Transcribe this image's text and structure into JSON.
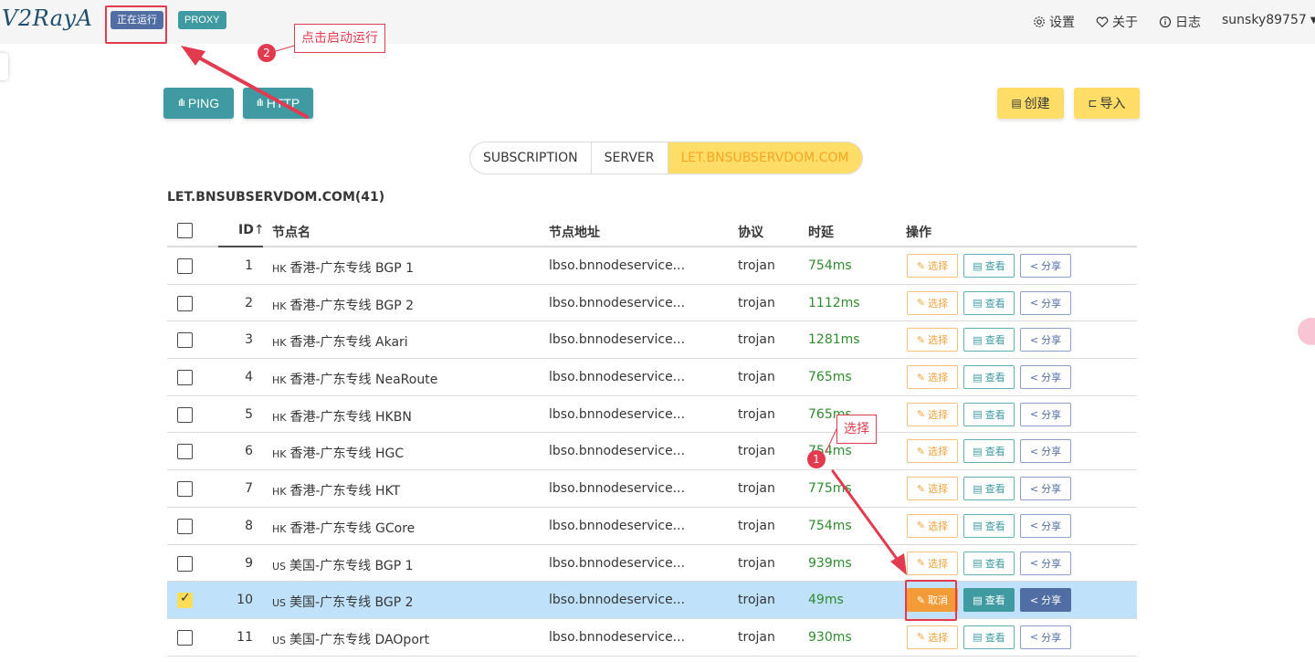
{
  "header": {
    "logo": "V2RayA",
    "status_tag": "正在运行",
    "proxy_tag": "PROXY",
    "nav": {
      "settings": "设置",
      "about": "关于",
      "log": "日志",
      "user": "sunsky89757"
    }
  },
  "toolbar": {
    "ping_label": "PING",
    "http_label": "HTTP",
    "create_label": "创建",
    "import_label": "导入"
  },
  "tabs": [
    {
      "label": "SUBSCRIPTION",
      "active": false
    },
    {
      "label": "SERVER",
      "active": false
    },
    {
      "label": "LET.BNSUBSERVDOM.COM",
      "active": true
    }
  ],
  "list": {
    "title": "LET.BNSUBSERVDOM.COM(41)",
    "columns": {
      "id": "ID",
      "name": "节点名",
      "address": "节点地址",
      "protocol": "协议",
      "latency": "时延",
      "actions": "操作"
    },
    "action_labels": {
      "select": "选择",
      "cancel": "取消",
      "view": "查看",
      "share": "分享"
    },
    "rows": [
      {
        "id": "1",
        "flag": "HK",
        "name": "香港-广东专线 BGP 1",
        "address": "lbso.bnnodeservice...",
        "protocol": "trojan",
        "latency": "754ms",
        "selected": false
      },
      {
        "id": "2",
        "flag": "HK",
        "name": "香港-广东专线 BGP 2",
        "address": "lbso.bnnodeservice...",
        "protocol": "trojan",
        "latency": "1112ms",
        "selected": false
      },
      {
        "id": "3",
        "flag": "HK",
        "name": "香港-广东专线 Akari",
        "address": "lbso.bnnodeservice...",
        "protocol": "trojan",
        "latency": "1281ms",
        "selected": false
      },
      {
        "id": "4",
        "flag": "HK",
        "name": "香港-广东专线 NeaRoute",
        "address": "lbso.bnnodeservice...",
        "protocol": "trojan",
        "latency": "765ms",
        "selected": false
      },
      {
        "id": "5",
        "flag": "HK",
        "name": "香港-广东专线 HKBN",
        "address": "lbso.bnnodeservice...",
        "protocol": "trojan",
        "latency": "765ms",
        "selected": false
      },
      {
        "id": "6",
        "flag": "HK",
        "name": "香港-广东专线 HGC",
        "address": "lbso.bnnodeservice...",
        "protocol": "trojan",
        "latency": "754ms",
        "selected": false
      },
      {
        "id": "7",
        "flag": "HK",
        "name": "香港-广东专线 HKT",
        "address": "lbso.bnnodeservice...",
        "protocol": "trojan",
        "latency": "775ms",
        "selected": false
      },
      {
        "id": "8",
        "flag": "HK",
        "name": "香港-广东专线 GCore",
        "address": "lbso.bnnodeservice...",
        "protocol": "trojan",
        "latency": "754ms",
        "selected": false
      },
      {
        "id": "9",
        "flag": "US",
        "name": "美国-广东专线 BGP 1",
        "address": "lbso.bnnodeservice...",
        "protocol": "trojan",
        "latency": "939ms",
        "selected": false
      },
      {
        "id": "10",
        "flag": "US",
        "name": "美国-广东专线 BGP 2",
        "address": "lbso.bnnodeservice...",
        "protocol": "trojan",
        "latency": "49ms",
        "selected": true
      },
      {
        "id": "11",
        "flag": "US",
        "name": "美国-广东专线 DAOport",
        "address": "lbso.bnnodeservice...",
        "protocol": "trojan",
        "latency": "930ms",
        "selected": false
      }
    ]
  },
  "annotations": {
    "step1_num": "1",
    "step1_label": "选择",
    "step2_num": "2",
    "step2_label": "点击启动运行",
    "color": "#e23a4e"
  }
}
